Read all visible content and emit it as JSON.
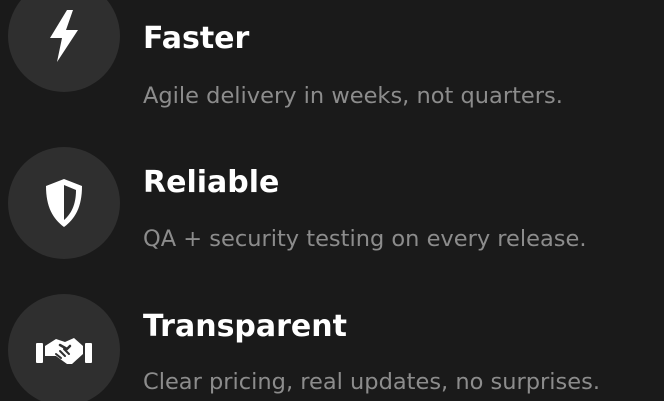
{
  "features": [
    {
      "title": "Faster",
      "description": "Agile delivery in weeks, not quarters.",
      "icon": "lightning-bolt-icon"
    },
    {
      "title": "Reliable",
      "description": "QA + security testing on every release.",
      "icon": "shield-icon"
    },
    {
      "title": "Transparent",
      "description": "Clear pricing, real updates, no surprises.",
      "icon": "handshake-icon"
    }
  ],
  "colors": {
    "background": "#1a1a1a",
    "icon_circle": "#2f2f2f",
    "title": "#ffffff",
    "description": "#8c8c8c"
  }
}
